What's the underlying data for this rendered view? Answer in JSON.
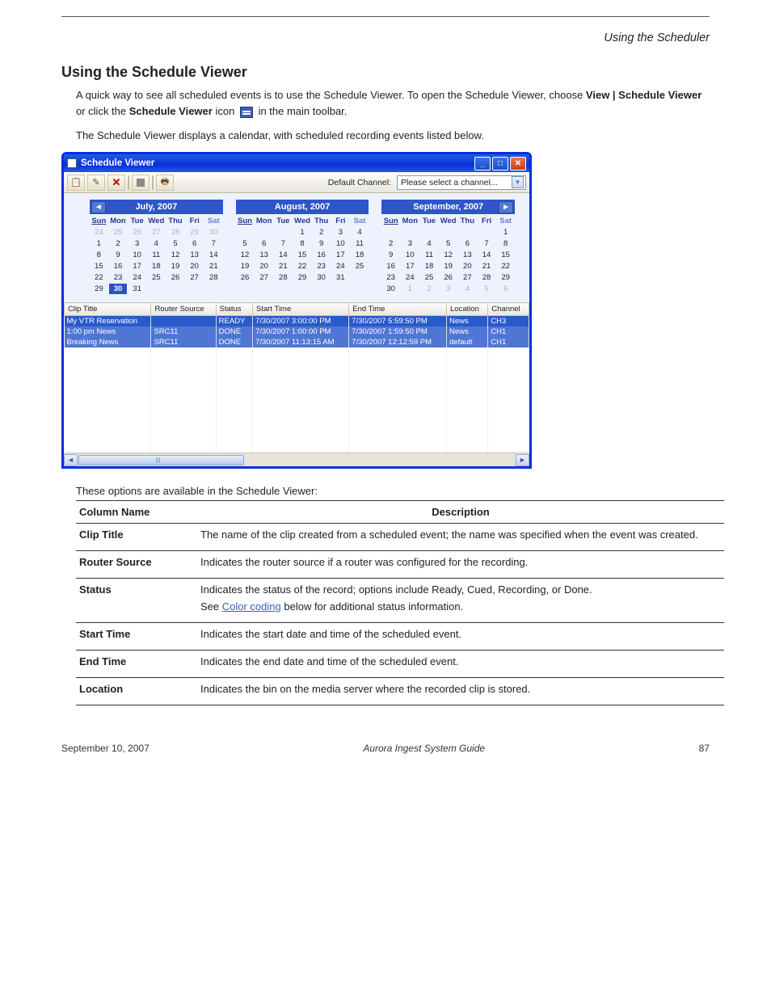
{
  "page_header": "Using the Scheduler",
  "section_title": "Using the Schedule Viewer",
  "body_para_1_pre": "A quick way to see all scheduled events is to use the Schedule Viewer. To open the Schedule Viewer, choose ",
  "body_para_1_bold": "View | Schedule Viewer",
  "body_para_1_mid": " or click the ",
  "body_para_1_bold2": "Schedule Viewer",
  "body_para_1_post_icon": " icon ",
  "body_para_1_end": " in the main toolbar.",
  "body_para_2": "The Schedule Viewer displays a calendar, with scheduled recording events listed below.",
  "window": {
    "title": "Schedule Viewer",
    "winbtns": {
      "min": "_",
      "max": "□",
      "close": "✕"
    },
    "default_channel_label": "Default Channel:",
    "default_channel_value": "Please select a channel..."
  },
  "calendars": [
    {
      "title": "July, 2007",
      "has_left_arrow": true,
      "has_right_arrow": false,
      "dow": [
        "Sun",
        "Mon",
        "Tue",
        "Wed",
        "Thu",
        "Fri",
        "Sat"
      ],
      "weeks": [
        [
          {
            "n": "24",
            "g": true
          },
          {
            "n": "25",
            "g": true
          },
          {
            "n": "26",
            "g": true
          },
          {
            "n": "27",
            "g": true
          },
          {
            "n": "28",
            "g": true
          },
          {
            "n": "29",
            "g": true
          },
          {
            "n": "30",
            "g": true
          }
        ],
        [
          {
            "n": "1"
          },
          {
            "n": "2"
          },
          {
            "n": "3"
          },
          {
            "n": "4"
          },
          {
            "n": "5"
          },
          {
            "n": "6"
          },
          {
            "n": "7"
          }
        ],
        [
          {
            "n": "8"
          },
          {
            "n": "9"
          },
          {
            "n": "10"
          },
          {
            "n": "11"
          },
          {
            "n": "12"
          },
          {
            "n": "13"
          },
          {
            "n": "14"
          }
        ],
        [
          {
            "n": "15"
          },
          {
            "n": "16"
          },
          {
            "n": "17"
          },
          {
            "n": "18"
          },
          {
            "n": "19"
          },
          {
            "n": "20"
          },
          {
            "n": "21"
          }
        ],
        [
          {
            "n": "22"
          },
          {
            "n": "23"
          },
          {
            "n": "24"
          },
          {
            "n": "25"
          },
          {
            "n": "26"
          },
          {
            "n": "27"
          },
          {
            "n": "28"
          }
        ],
        [
          {
            "n": "29"
          },
          {
            "n": "30",
            "sel": true
          },
          {
            "n": "31"
          },
          {
            "n": ""
          },
          {
            "n": ""
          },
          {
            "n": ""
          },
          {
            "n": ""
          }
        ]
      ]
    },
    {
      "title": "August, 2007",
      "has_left_arrow": false,
      "has_right_arrow": false,
      "dow": [
        "Sun",
        "Mon",
        "Tue",
        "Wed",
        "Thu",
        "Fri",
        "Sat"
      ],
      "weeks": [
        [
          {
            "n": ""
          },
          {
            "n": ""
          },
          {
            "n": ""
          },
          {
            "n": "1"
          },
          {
            "n": "2"
          },
          {
            "n": "3"
          },
          {
            "n": "4"
          }
        ],
        [
          {
            "n": "5"
          },
          {
            "n": "6"
          },
          {
            "n": "7"
          },
          {
            "n": "8"
          },
          {
            "n": "9"
          },
          {
            "n": "10"
          },
          {
            "n": "11"
          }
        ],
        [
          {
            "n": "12"
          },
          {
            "n": "13"
          },
          {
            "n": "14"
          },
          {
            "n": "15"
          },
          {
            "n": "16"
          },
          {
            "n": "17"
          },
          {
            "n": "18"
          }
        ],
        [
          {
            "n": "19"
          },
          {
            "n": "20"
          },
          {
            "n": "21"
          },
          {
            "n": "22"
          },
          {
            "n": "23"
          },
          {
            "n": "24"
          },
          {
            "n": "25"
          }
        ],
        [
          {
            "n": "26"
          },
          {
            "n": "27"
          },
          {
            "n": "28"
          },
          {
            "n": "29"
          },
          {
            "n": "30"
          },
          {
            "n": "31"
          },
          {
            "n": ""
          }
        ],
        [
          {
            "n": ""
          },
          {
            "n": ""
          },
          {
            "n": ""
          },
          {
            "n": ""
          },
          {
            "n": ""
          },
          {
            "n": ""
          },
          {
            "n": ""
          }
        ]
      ]
    },
    {
      "title": "September, 2007",
      "has_left_arrow": false,
      "has_right_arrow": true,
      "dow": [
        "Sun",
        "Mon",
        "Tue",
        "Wed",
        "Thu",
        "Fri",
        "Sat"
      ],
      "weeks": [
        [
          {
            "n": ""
          },
          {
            "n": ""
          },
          {
            "n": ""
          },
          {
            "n": ""
          },
          {
            "n": ""
          },
          {
            "n": ""
          },
          {
            "n": "1"
          }
        ],
        [
          {
            "n": "2"
          },
          {
            "n": "3"
          },
          {
            "n": "4"
          },
          {
            "n": "5"
          },
          {
            "n": "6"
          },
          {
            "n": "7"
          },
          {
            "n": "8"
          }
        ],
        [
          {
            "n": "9"
          },
          {
            "n": "10"
          },
          {
            "n": "11"
          },
          {
            "n": "12"
          },
          {
            "n": "13"
          },
          {
            "n": "14"
          },
          {
            "n": "15"
          }
        ],
        [
          {
            "n": "16"
          },
          {
            "n": "17"
          },
          {
            "n": "18"
          },
          {
            "n": "19"
          },
          {
            "n": "20"
          },
          {
            "n": "21"
          },
          {
            "n": "22"
          }
        ],
        [
          {
            "n": "23"
          },
          {
            "n": "24"
          },
          {
            "n": "25"
          },
          {
            "n": "26"
          },
          {
            "n": "27"
          },
          {
            "n": "28"
          },
          {
            "n": "29"
          }
        ],
        [
          {
            "n": "30"
          },
          {
            "n": "1",
            "g": true
          },
          {
            "n": "2",
            "g": true
          },
          {
            "n": "3",
            "g": true
          },
          {
            "n": "4",
            "g": true
          },
          {
            "n": "5",
            "g": true
          },
          {
            "n": "6",
            "g": true
          }
        ]
      ]
    }
  ],
  "grid_headers": [
    "Clip Title",
    "Router Source",
    "Status",
    "Start Time",
    "End Time",
    "Location",
    "Channel"
  ],
  "grid_rows": [
    {
      "sel": true,
      "cells": [
        "My VTR Reservation",
        "",
        "READY",
        "7/30/2007 3:00:00 PM",
        "7/30/2007 5:59:50 PM",
        "News",
        "CH3"
      ]
    },
    {
      "sel": false,
      "cells": [
        "1:00 pm News",
        "SRC11",
        "DONE",
        "7/30/2007 1:00:00 PM",
        "7/30/2007 1:59:50 PM",
        "News",
        "CH1"
      ]
    },
    {
      "sel": false,
      "cells": [
        "Breaking News",
        "SRC11",
        "DONE",
        "7/30/2007 11:13:15 AM",
        "7/30/2007 12:12:59 PM",
        "default",
        "CH1"
      ]
    }
  ],
  "info_intro": "These options are available in the Schedule Viewer:",
  "info_headers": [
    "Column Name",
    "Description"
  ],
  "info_rows": [
    {
      "name": "Clip Title",
      "desc": "The name of the clip created from a scheduled event; the name was specified when the event was created."
    },
    {
      "name": "Router Source",
      "desc": "Indicates the router source if a router was configured for the recording."
    },
    {
      "name": "Status",
      "desc": "Indicates the status of the record; options include Ready, Cued, Recording, or Done.",
      "sub_pre": "See ",
      "sub_link": "Color coding",
      "sub_post": " below for additional status information."
    },
    {
      "name": "Start Time",
      "desc": "Indicates the start date and time of the scheduled event."
    },
    {
      "name": "End Time",
      "desc": "Indicates the end date and time of the scheduled event."
    },
    {
      "name": "Location",
      "desc": "Indicates the bin on the media server where the recorded clip is stored."
    }
  ],
  "footer": {
    "date": "September 10, 2007",
    "title": "Aurora Ingest System Guide",
    "page": "87"
  }
}
